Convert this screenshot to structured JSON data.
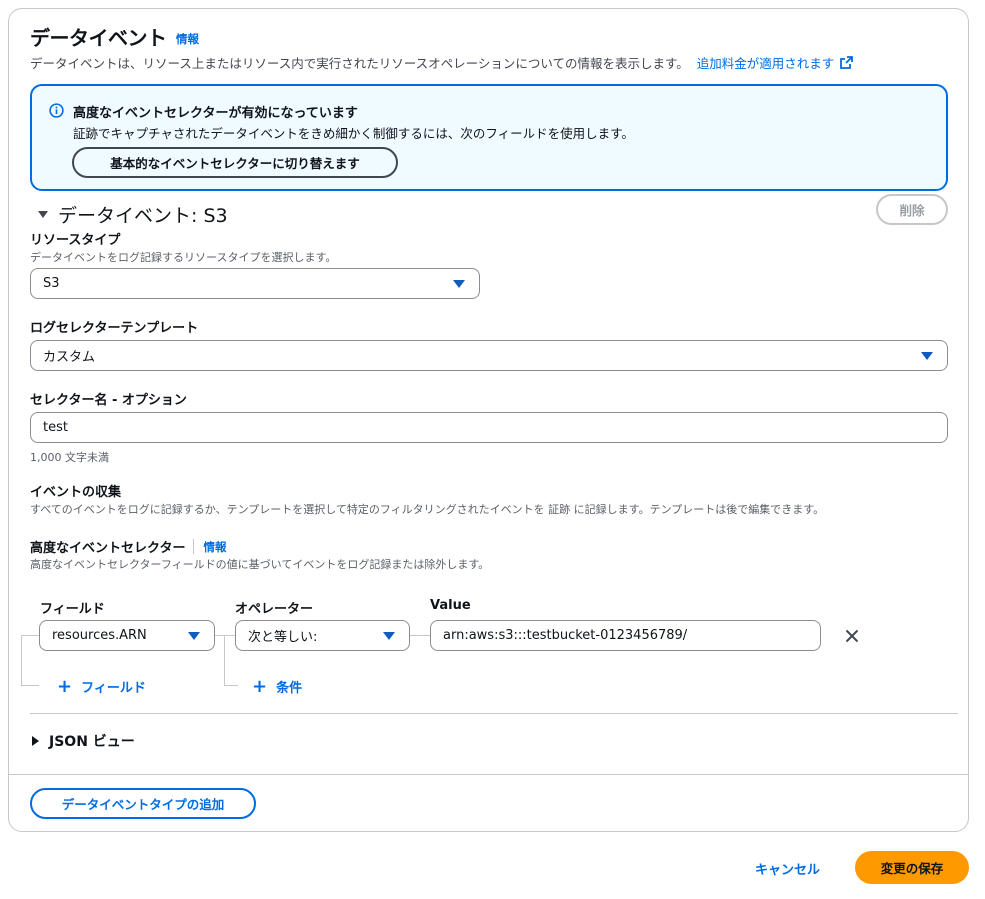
{
  "section": {
    "title": "データイベント",
    "info_label": "情報",
    "description": "データイベントは、リソース上またはリソース内で実行されたリソースオペレーションについての情報を表示します。",
    "extra_charge_link": "追加料金が適用されます"
  },
  "alert": {
    "title": "高度なイベントセレクターが有効になっています",
    "body": "証跡でキャプチャされたデータイベントをきめ細かく制御するには、次のフィールドを使用します。",
    "switch_button": "基本的なイベントセレクターに切り替えます"
  },
  "data_event": {
    "header": "データイベント: S3",
    "delete_button": "削除",
    "resource_type": {
      "label": "リソースタイプ",
      "description": "データイベントをログ記録するリソースタイプを選択します。",
      "value": "S3"
    },
    "log_selector_template": {
      "label": "ログセレクターテンプレート",
      "value": "カスタム"
    },
    "selector_name": {
      "label": "セレクター名 - オプション",
      "value": "test",
      "constraint": "1,000 文字未満"
    },
    "event_collection": {
      "label": "イベントの収集",
      "description": "すべてのイベントをログに記録するか、テンプレートを選択して特定のフィルタリングされたイベントを 証跡 に記録します。テンプレートは後で編集できます。"
    },
    "advanced_selector": {
      "label": "高度なイベントセレクター",
      "info_label": "情報",
      "description": "高度なイベントセレクターフィールドの値に基づいてイベントをログ記録または除外します。",
      "columns": {
        "field": "フィールド",
        "operator": "オペレーター",
        "value": "Value"
      },
      "row": {
        "field": "resources.ARN",
        "operator": "次と等しい:",
        "value": "arn:aws:s3:::testbucket-0123456789/"
      },
      "add_field": "フィールド",
      "add_condition": "条件"
    },
    "json_view": "JSON ビュー"
  },
  "add_data_event_type_button": "データイベントタイプの追加",
  "footer": {
    "cancel": "キャンセル",
    "save": "変更の保存"
  },
  "colors": {
    "link": "#006ce0",
    "primary": "#ff9900",
    "alert_bg": "#f0fbff"
  },
  "icons": [
    "info-icon",
    "external-link-icon",
    "caret-down-icon",
    "close-icon",
    "plus-icon",
    "expand-icon",
    "collapse-icon"
  ]
}
